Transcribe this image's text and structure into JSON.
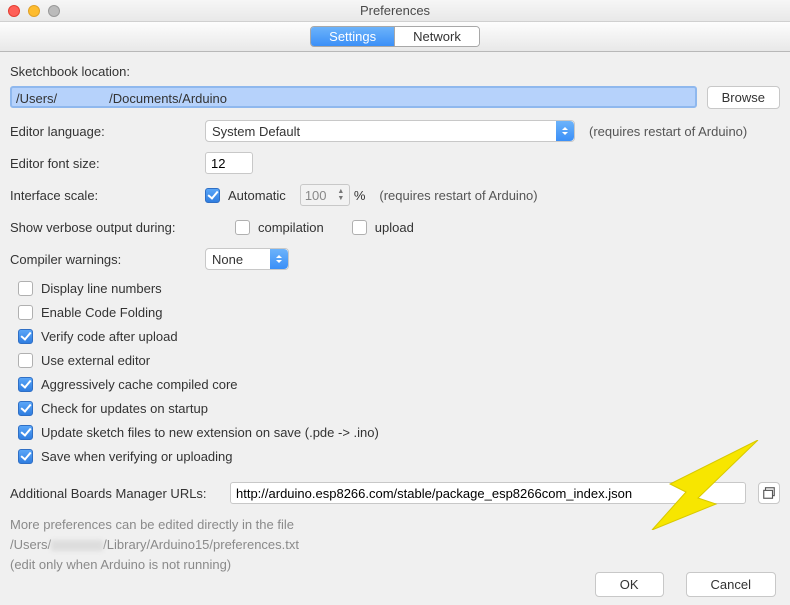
{
  "window": {
    "title": "Preferences"
  },
  "tabs": {
    "settings": "Settings",
    "network": "Network"
  },
  "sketchbook": {
    "label": "Sketchbook location:",
    "path": "/Users/　　　　/Documents/Arduino",
    "browse": "Browse"
  },
  "editorLanguage": {
    "label": "Editor language:",
    "value": "System Default",
    "hint": "(requires restart of Arduino)"
  },
  "fontSize": {
    "label": "Editor font size:",
    "value": "12"
  },
  "interfaceScale": {
    "label": "Interface scale:",
    "autoLabel": "Automatic",
    "value": "100",
    "unit": "%",
    "hint": "(requires restart of Arduino)"
  },
  "verbose": {
    "label": "Show verbose output during:",
    "compilation": "compilation",
    "upload": "upload"
  },
  "compilerWarnings": {
    "label": "Compiler warnings:",
    "value": "None"
  },
  "checks": {
    "displayLineNumbers": "Display line numbers",
    "enableCodeFolding": "Enable Code Folding",
    "verifyAfterUpload": "Verify code after upload",
    "externalEditor": "Use external editor",
    "aggrCache": "Aggressively cache compiled core",
    "checkUpdates": "Check for updates on startup",
    "updateExt": "Update sketch files to new extension on save (.pde -> .ino)",
    "saveVerify": "Save when verifying or uploading"
  },
  "boardsUrls": {
    "label": "Additional Boards Manager URLs:",
    "value": "http://arduino.esp8266.com/stable/package_esp8266com_index.json"
  },
  "footnote": {
    "line1": "More preferences can be edited directly in the file",
    "line2_pre": "/Users/",
    "line2_post": "/Library/Arduino15/preferences.txt",
    "line3": "(edit only when Arduino is not running)"
  },
  "buttons": {
    "ok": "OK",
    "cancel": "Cancel"
  }
}
